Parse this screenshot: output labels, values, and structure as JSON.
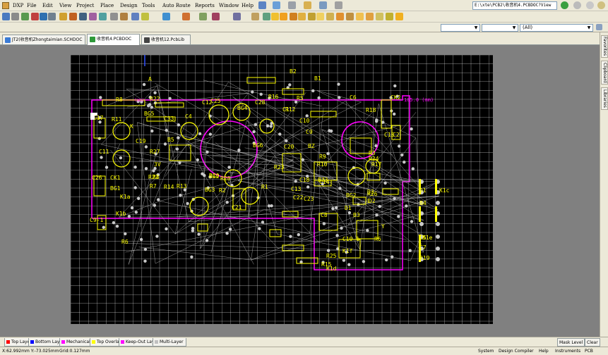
{
  "menubar": {
    "items": [
      "DXP",
      "File",
      "Edit",
      "View",
      "Project",
      "Place",
      "Design",
      "Tools",
      "Auto Route",
      "Reports",
      "Window",
      "Help"
    ],
    "path_text": "E:\\xte\\PCB2\\收音机4.PCBDOC?View"
  },
  "toolbar3": {
    "combo1_value": "",
    "combo2_value": "",
    "combo3_value": "(All)"
  },
  "tabs": [
    {
      "label": "JT2(收音机Zhongtaimian.SCHDOC",
      "icon_color": "#3a7bd5"
    },
    {
      "label": "收音机4.PCBDOC",
      "icon_color": "#2f9a3a",
      "active": true
    },
    {
      "label": "收音机12.PcbLib",
      "icon_color": "#444444"
    }
  ],
  "right_panel": {
    "tabs": [
      "Favorites",
      "Clipboard",
      "Libraries"
    ]
  },
  "pcb": {
    "labels_yellow": [
      "A",
      "B2",
      "B1",
      "R8",
      "R22",
      "C12",
      "C25",
      "BG4",
      "C28",
      "R16",
      "R5",
      "C1",
      "C6",
      "CK2",
      "C17",
      "R11",
      "BG5",
      "C33",
      "C4",
      "R12",
      "C10",
      "R18",
      "K",
      "B5",
      "C9",
      "C19",
      "R27",
      "BG6",
      "C20",
      "BZ",
      "C15",
      "C2",
      "C11",
      "3V",
      "R21",
      "R10",
      "R3",
      "R24",
      "R9",
      "R26",
      "R17",
      "C26",
      "CK1",
      "R4",
      "R20",
      "BG2",
      "R28",
      "R23",
      "BG3",
      "BG1",
      "R7",
      "R14",
      "R13",
      "R2",
      "R1",
      "C13",
      "BZ3",
      "C14",
      "C18",
      "BG2",
      "D3",
      "D2",
      "D1",
      "K1c",
      "K1a",
      "C21",
      "C22",
      "L",
      "C23",
      "D1",
      "C8",
      "B3",
      "B4",
      "K1b",
      "C9-1",
      "Y",
      "C10-1",
      "R6",
      "C5",
      "C7",
      "K1e",
      "K1f",
      "R25",
      "R19",
      "K1d",
      "R15",
      "R6"
    ],
    "label_dim1": "105.0 (mm)",
    "label_dim2": "(mm)"
  },
  "layers": [
    {
      "name": "Top Layer",
      "color": "#ff0000"
    },
    {
      "name": "Bottom Layer",
      "color": "#0000ff"
    },
    {
      "name": "Mechanical 1",
      "color": "#ff00ff"
    },
    {
      "name": "Top Overlay",
      "color": "#ffff00"
    },
    {
      "name": "Keep-Out Layer",
      "color": "#ff00ff"
    },
    {
      "name": "Multi-Layer",
      "color": "#c0c0c0"
    }
  ],
  "layerbar": {
    "mask_level": "Mask Level",
    "clear": "Clear"
  },
  "status": {
    "coords": "X:62.992mm Y:-73.025mm",
    "grid": "Grid:0.127mm",
    "right_items": [
      "System",
      "Design Compiler",
      "Help",
      "Instruments",
      "PCB"
    ]
  },
  "colors": {
    "silkscreen": "#ffff00",
    "keepout": "#ff00ff",
    "grid": "#ffffff",
    "ratsnest": "#c0c0c0",
    "board": "#000000"
  }
}
